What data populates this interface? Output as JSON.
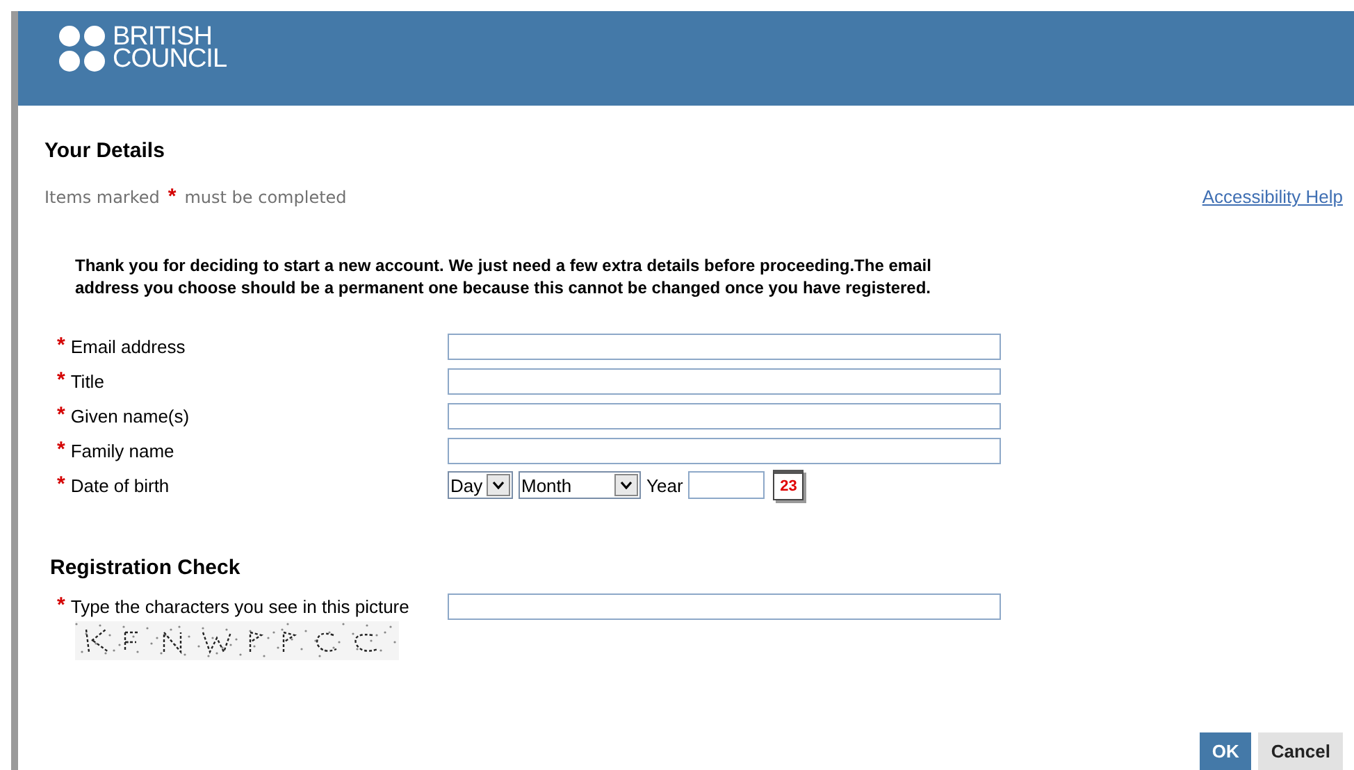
{
  "header": {
    "logo_line_1": "BRITISH",
    "logo_line_2": "COUNCIL"
  },
  "section_title": "Your Details",
  "required_note": {
    "before": "Items marked",
    "marker": "*",
    "after": "must be completed"
  },
  "help_link": "Accessibility Help",
  "intro": "Thank you for deciding to start a new account. We just need a few extra details before proceeding.The email address you choose should be a permanent one because this cannot be changed once you have registered.",
  "fields": [
    {
      "kind": "text",
      "required": true,
      "label": "Email address"
    },
    {
      "kind": "text",
      "required": true,
      "label": "Title"
    },
    {
      "kind": "text",
      "required": true,
      "label": "Given name(s)"
    },
    {
      "kind": "text",
      "required": true,
      "label": "Family name"
    },
    {
      "kind": "date",
      "required": true,
      "label": "Date of birth",
      "day": "Day",
      "month": "Month",
      "year_label": "Year",
      "calendar_day": "23"
    }
  ],
  "check_title": "Registration Check",
  "captcha": {
    "required": true,
    "label": "Type the characters you see in this picture",
    "kind": "picture"
  },
  "buttons": [
    {
      "label": "OK",
      "primary": true
    },
    {
      "label": "Cancel",
      "primary": false
    }
  ]
}
